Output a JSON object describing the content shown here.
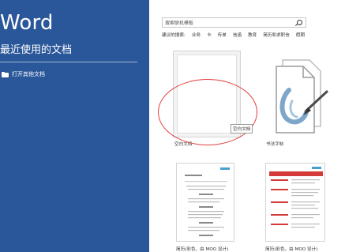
{
  "left": {
    "app_title": "Word",
    "recent_heading": "最近使用的文档",
    "open_other": "打开其他文档"
  },
  "search": {
    "placeholder": "搜索联机模板"
  },
  "suggested": [
    "建议的搜索:",
    "业务",
    "卡",
    "传单",
    "信函",
    "教育",
    "简历和求职信",
    "假期"
  ],
  "templates": {
    "blank_label": "空白文档",
    "blank_tooltip": "空白文档",
    "tour_label": "书法字帖",
    "resume1_label": "简历(彩色，由 MOO 设计)",
    "resume2_label": "简历(彩色，由 MOO 设计)"
  },
  "colors": {
    "sidebar": "#2a579a",
    "annotation": "#e04040",
    "resume_accent": "#d43a3a"
  }
}
